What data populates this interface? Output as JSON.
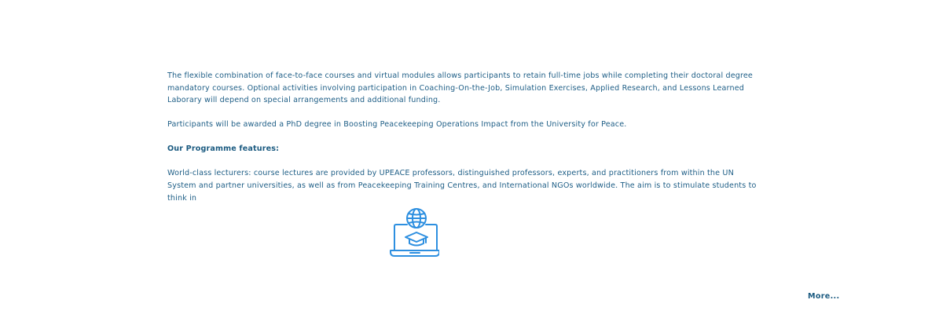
{
  "article": {
    "paragraph_1": "The flexible combination of face-to-face courses and virtual modules allows participants to retain full-time jobs while completing their doctoral degree mandatory courses. Optional activities involving participation in Coaching-On-the-Job, Simulation Exercises, Applied Research, and Lessons Learned Laborary will depend on special arrangements and additional funding.",
    "paragraph_2": "Participants will be awarded a PhD degree in Boosting Peacekeeping Operations Impact from the University for Peace.",
    "features_heading": "Our Programme features:",
    "paragraph_3": "World-class lecturers: course lectures are provided by UPEACE professors, distinguished professors, experts, and practitioners from within the UN System and partner universities, as well as from Peacekeeping Training Centres, and International NGOs worldwide. The aim is to stimulate students to think in"
  },
  "illustration": {
    "icon": "online-education-laptop-icon",
    "color": "#2d8fe0"
  },
  "more_link": "More..."
}
